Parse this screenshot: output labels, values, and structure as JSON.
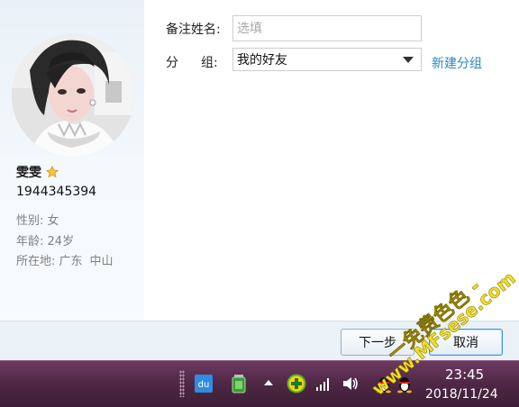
{
  "profile": {
    "nickname": "雯雯",
    "qq_number": "1944345394",
    "gender_label": "性别:",
    "gender": "女",
    "age_label": "年龄:",
    "age": "24岁",
    "location_label": "所在地:",
    "location_province": "广东",
    "location_city": "中山"
  },
  "form": {
    "remark_label": "备注姓名:",
    "remark_placeholder": "选填",
    "remark_value": "",
    "group_label_1": "分",
    "group_label_2": "组:",
    "group_value": "我的好友",
    "new_group_link": "新建分组"
  },
  "buttons": {
    "next": "下一步",
    "cancel": "取消"
  },
  "taskbar": {
    "time": "23:45",
    "date": "2018/11/24",
    "icons": [
      "baidu-du-icon",
      "battery-usb-icon",
      "show-hidden-icons-arrow",
      "360-plus-icon",
      "network-signal-icon",
      "volume-icon",
      "qq-penguin-icon",
      "qq-penguin-icon"
    ]
  },
  "watermark": {
    "text_line_1": "一免费色色 -",
    "text_line_2": "www.MFsese.com"
  },
  "colors": {
    "link": "#2a87c8",
    "taskbar": "#4e2744",
    "sidebar": "#f1f6fb",
    "watermark": "#f2e020"
  }
}
